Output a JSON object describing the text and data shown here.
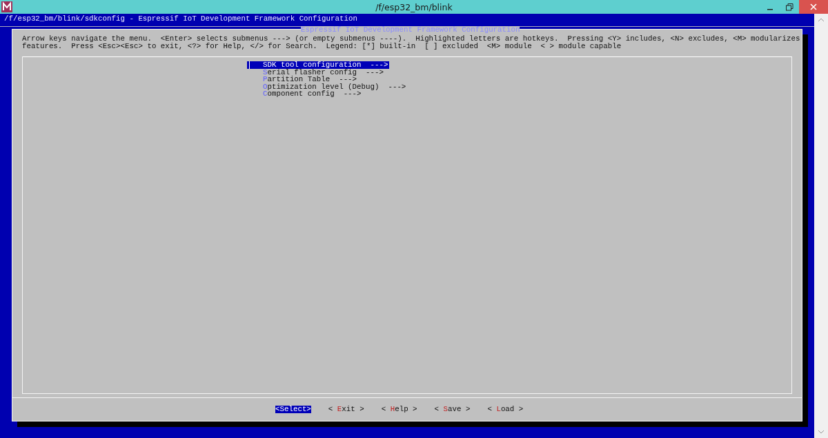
{
  "window": {
    "title": "/f/esp32_bm/blink"
  },
  "terminal_header": "/f/esp32_bm/blink/sdkconfig - Espressif IoT Development Framework Configuration",
  "dialog": {
    "title": "Espressif IoT Development Framework Configuration",
    "help_lines": [
      "Arrow keys navigate the menu.  <Enter> selects submenus ---> (or empty submenus ----).  Highlighted letters are hotkeys.  Pressing <Y> includes, <N> excludes, <M> modularizes",
      "features.  Press <Esc><Esc> to exit, <?> for Help, </> for Search.  Legend: [*] built-in  [ ] excluded  <M> module  < > module capable"
    ],
    "menu_items": [
      {
        "hotkey": "S",
        "rest": "DK tool configuration  --->",
        "selected": true
      },
      {
        "hotkey": "S",
        "rest": "erial flasher config  --->",
        "selected": false
      },
      {
        "hotkey": "P",
        "rest": "artition Table  --->",
        "selected": false
      },
      {
        "hotkey": "O",
        "rest": "ptimization level (Debug)  --->",
        "selected": false
      },
      {
        "hotkey": "C",
        "rest": "omponent config  --->",
        "selected": false
      }
    ],
    "buttons": [
      {
        "before": "<",
        "hotkey": "S",
        "after": "elect>",
        "selected": true
      },
      {
        "before": "< ",
        "hotkey": "E",
        "after": "xit >",
        "selected": false
      },
      {
        "before": "< ",
        "hotkey": "H",
        "after": "elp >",
        "selected": false
      },
      {
        "before": "< ",
        "hotkey": "S",
        "after": "ave >",
        "selected": false
      },
      {
        "before": "< ",
        "hotkey": "L",
        "after": "oad >",
        "selected": false
      }
    ]
  }
}
